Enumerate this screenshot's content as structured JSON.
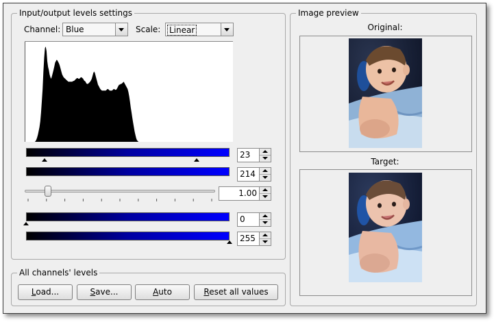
{
  "io_group": {
    "title": "Input/output levels settings",
    "channel_label": "Channel:",
    "channel_value": "Blue",
    "scale_label": "Scale:",
    "scale_value": "Linear",
    "histogram": {
      "type": "area",
      "x_range": [
        0,
        255
      ],
      "values": [
        0,
        0,
        0,
        0,
        0,
        0,
        0,
        0,
        0,
        0,
        0,
        0,
        0,
        0,
        1,
        3,
        6,
        10,
        15,
        20,
        28,
        40,
        55,
        72,
        95,
        115,
        128,
        130,
        124,
        110,
        102,
        98,
        92,
        88,
        86,
        90,
        94,
        98,
        103,
        108,
        110,
        112,
        111,
        109,
        107,
        104,
        100,
        96,
        92,
        90,
        88,
        87,
        86,
        85,
        84,
        83,
        82,
        82,
        82,
        82,
        82,
        82,
        83,
        83,
        84,
        85,
        86,
        87,
        87,
        86,
        86,
        87,
        88,
        88,
        87,
        86,
        84,
        83,
        82,
        80,
        79,
        79,
        80,
        81,
        82,
        84,
        86,
        90,
        94,
        96,
        94,
        90,
        86,
        82,
        78,
        76,
        74,
        72,
        71,
        70,
        70,
        70,
        70,
        70,
        70,
        71,
        72,
        72,
        71,
        70,
        70,
        70,
        70,
        71,
        72,
        72,
        71,
        71,
        72,
        74,
        76,
        78,
        78,
        79,
        79,
        80,
        81,
        82,
        80,
        78,
        76,
        74,
        72,
        68,
        62,
        55,
        47,
        40,
        33,
        26,
        20,
        14,
        9,
        5,
        2,
        1,
        0,
        0,
        0,
        0,
        0,
        0,
        0,
        0,
        0,
        0,
        0,
        0,
        0,
        0,
        0,
        0,
        0,
        0,
        0,
        0,
        0,
        0,
        0,
        0,
        0,
        0,
        0,
        0,
        0,
        0,
        0,
        0,
        0,
        0,
        0,
        0,
        0,
        0,
        0,
        0,
        0,
        0,
        0,
        0,
        0,
        0,
        0,
        0,
        0,
        0,
        0,
        0,
        0,
        0,
        0,
        0,
        0,
        0,
        0,
        0,
        0,
        0,
        0,
        0,
        0,
        0,
        0,
        0,
        0,
        0,
        0,
        0,
        0,
        0,
        0,
        0,
        0,
        0,
        0,
        0,
        0,
        0,
        0,
        0,
        0,
        0,
        0,
        0,
        0,
        0,
        0,
        0,
        0,
        0,
        0,
        0,
        0,
        0,
        0,
        0,
        0,
        0,
        0,
        0,
        0,
        0,
        0,
        0,
        0,
        0,
        0,
        0,
        0,
        0,
        0,
        0,
        0,
        0,
        0,
        0,
        0,
        0
      ]
    },
    "input_low": {
      "value": "23",
      "position": 0.09
    },
    "input_high": {
      "value": "214",
      "position": 0.84
    },
    "gamma": {
      "value": "1.00",
      "position": 0.11
    },
    "output_low": {
      "value": "0",
      "position": 0.0
    },
    "output_high": {
      "value": "255",
      "position": 1.0
    },
    "gradient_colors": [
      "#000000",
      "#0000ff"
    ]
  },
  "all_channels": {
    "title": "All channels' levels",
    "load": {
      "pre": "",
      "ul": "L",
      "post": "oad..."
    },
    "save": {
      "pre": "",
      "ul": "S",
      "post": "ave..."
    },
    "auto": {
      "pre": "",
      "ul": "A",
      "post": "uto"
    },
    "reset": {
      "pre": "",
      "ul": "R",
      "post": "eset all values"
    }
  },
  "preview": {
    "title": "Image preview",
    "original_label": "Original:",
    "target_label": "Target:"
  }
}
